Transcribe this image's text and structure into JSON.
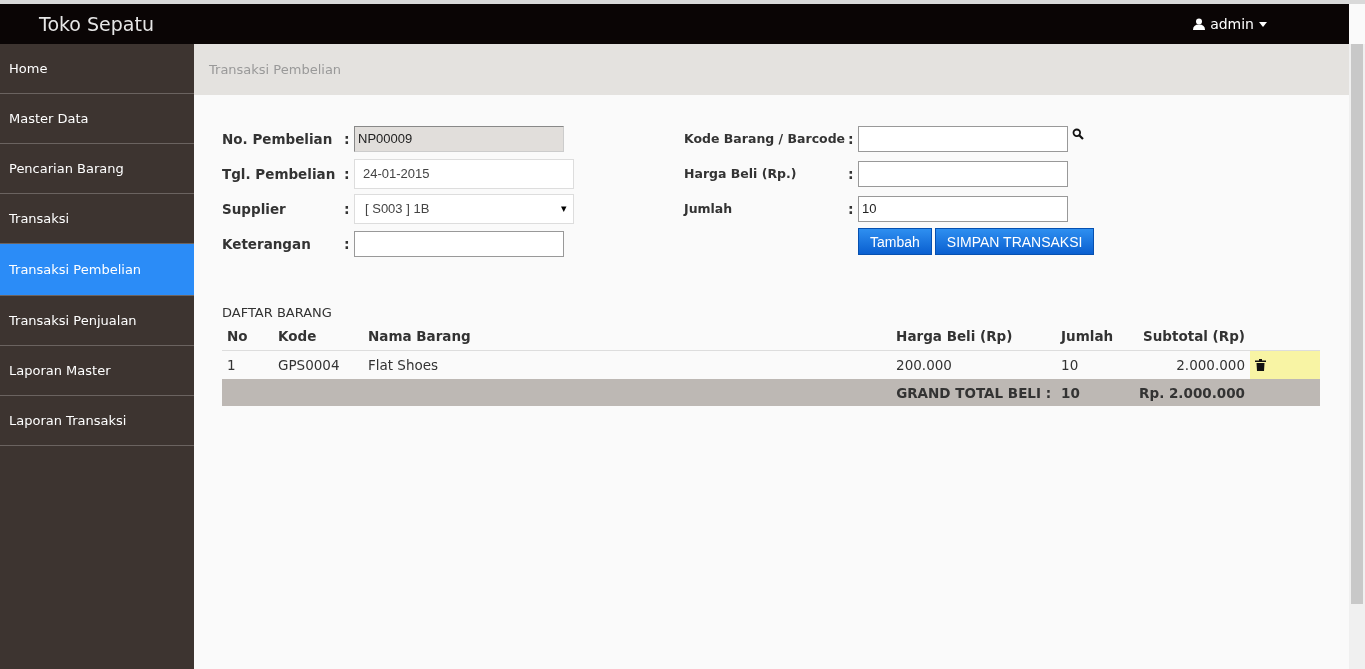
{
  "navbar": {
    "brand": "Toko Sepatu",
    "user": "admin"
  },
  "sidebar": {
    "items": [
      {
        "label": "Home",
        "selected": false
      },
      {
        "label": "Master Data",
        "selected": false
      },
      {
        "label": "Pencarian Barang",
        "selected": false
      },
      {
        "label": "Transaksi",
        "selected": false
      },
      {
        "label": "Transaksi Pembelian",
        "selected": true
      },
      {
        "label": "Transaksi Penjualan",
        "selected": false
      },
      {
        "label": "Laporan Master",
        "selected": false
      },
      {
        "label": "Laporan Transaksi",
        "selected": false
      }
    ]
  },
  "breadcrumb": "Transaksi Pembelian",
  "form_left": [
    {
      "label": "No. Pembelian",
      "separator": ":",
      "kind": "readonly",
      "value": "NP00009"
    },
    {
      "label": "Tgl. Pembelian",
      "separator": ":",
      "kind": "date",
      "value": "24-01-2015"
    },
    {
      "label": "Supplier",
      "separator": ":",
      "kind": "select",
      "value": "[ S003 ] 1B",
      "arrow": "▾"
    },
    {
      "label": "Keterangan",
      "separator": ":",
      "kind": "text"
    }
  ],
  "form_right": [
    {
      "label": "Kode Barang / Barcode",
      "separator": ":",
      "kind": "search"
    },
    {
      "label": "Harga Beli (Rp.)",
      "separator": ":",
      "kind": "text"
    },
    {
      "label": "Jumlah",
      "separator": ":",
      "kind": "text",
      "value": "10"
    }
  ],
  "buttons": [
    "Tambah",
    "SIMPAN TRANSAKSI"
  ],
  "table": {
    "title": "DAFTAR BARANG",
    "columns": [
      "No",
      "Kode",
      "Nama Barang",
      "Harga Beli (Rp)",
      "Jumlah",
      "Subtotal (Rp)"
    ],
    "rows": [
      {
        "cells": [
          "1",
          "GPS0004",
          "Flat Shoes",
          "200.000",
          "10",
          "2.000.000"
        ]
      }
    ],
    "total": {
      "label": "GRAND TOTAL BELI :",
      "jumlah": "10",
      "subtotal": "Rp. 2.000.000"
    }
  }
}
